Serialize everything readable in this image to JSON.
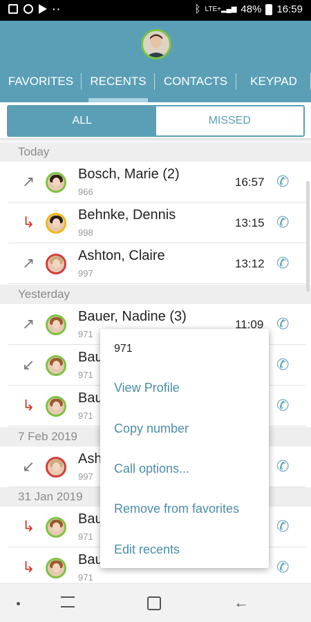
{
  "status_bar": {
    "icons_left": [
      "gallery-icon",
      "shield-icon",
      "play-icon",
      "more-dots-icon"
    ],
    "icons_right": [
      "bluetooth-icon",
      "lte-signal-icon",
      "battery-icon"
    ],
    "network": "LTE+",
    "battery": "48%",
    "time": "16:59"
  },
  "header": {
    "tabs": [
      {
        "label": "FAVORITES"
      },
      {
        "label": "RECENTS"
      },
      {
        "label": "CONTACTS"
      },
      {
        "label": "KEYPAD"
      }
    ],
    "active_tab": "RECENTS"
  },
  "filter": {
    "all_label": "ALL",
    "missed_label": "MISSED",
    "selected": "ALL"
  },
  "sections": [
    {
      "label": "Today"
    },
    {
      "label": "Yesterday"
    },
    {
      "label": "7 Feb 2019"
    },
    {
      "label": "31 Jan 2019"
    }
  ],
  "calls": [
    {
      "name": "Bosch, Marie (2)",
      "number": "966",
      "time": "16:57",
      "type": "outgoing",
      "ring": "green"
    },
    {
      "name": "Behnke, Dennis",
      "number": "998",
      "time": "13:15",
      "type": "missed",
      "ring": "yellow"
    },
    {
      "name": "Ashton, Claire",
      "number": "997",
      "time": "13:12",
      "type": "outgoing",
      "ring": "red"
    },
    {
      "name": "Bauer, Nadine (3)",
      "number": "971",
      "time": "11:09",
      "type": "outgoing",
      "ring": "green"
    },
    {
      "name": "Bau",
      "number": "971",
      "time": "",
      "type": "incoming",
      "ring": "green"
    },
    {
      "name": "Bau",
      "number": "971",
      "time": "",
      "type": "missed",
      "ring": "green"
    },
    {
      "name": "Ash",
      "number": "997",
      "time": "",
      "type": "incoming",
      "ring": "red"
    },
    {
      "name": "Bau",
      "number": "971",
      "time": "",
      "type": "missed",
      "ring": "green"
    },
    {
      "name": "Bau",
      "number": "971",
      "time": "",
      "type": "missed",
      "ring": "green"
    }
  ],
  "context_menu": {
    "title": "971",
    "items": [
      {
        "label": "View Profile"
      },
      {
        "label": "Copy number"
      },
      {
        "label": "Call options..."
      },
      {
        "label": "Remove from favorites"
      },
      {
        "label": "Edit recents"
      }
    ]
  },
  "colors": {
    "accent": "#5b9fb7",
    "missed": "#d23a2f",
    "ring_green": "#7cc242",
    "ring_red": "#d53a3a",
    "ring_yellow": "#f1b814"
  }
}
